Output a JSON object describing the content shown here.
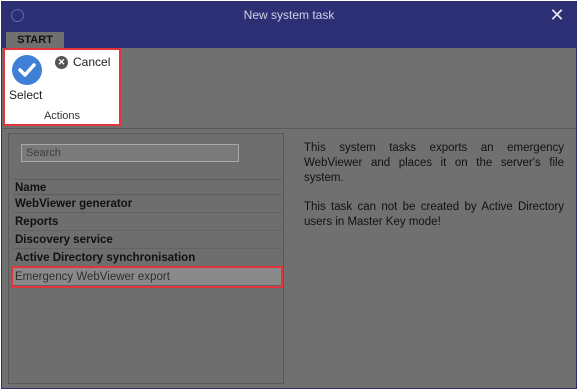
{
  "window": {
    "title": "New system task",
    "close_symbol": "✕"
  },
  "tabs": [
    {
      "label": "START"
    }
  ],
  "ribbon": {
    "select_label": "Select",
    "cancel_label": "Cancel",
    "group_label": "Actions"
  },
  "search": {
    "placeholder": "Search",
    "value": ""
  },
  "list": {
    "header": "Name",
    "items": [
      {
        "label": "WebViewer generator"
      },
      {
        "label": "Reports"
      },
      {
        "label": "Discovery service"
      },
      {
        "label": "Active Directory synchronisation"
      },
      {
        "label": "Emergency WebViewer export",
        "selected": true
      }
    ]
  },
  "description": {
    "paragraph1": "This system tasks exports an emergency WebViewer and places it on the server's file system.",
    "paragraph2": "This task can not be created by Active Directory users in Master Key mode!"
  },
  "colors": {
    "titlebar": "#2c2f74",
    "background": "#707070",
    "highlight": "#e2343a",
    "accent_blue": "#3f80d6"
  }
}
